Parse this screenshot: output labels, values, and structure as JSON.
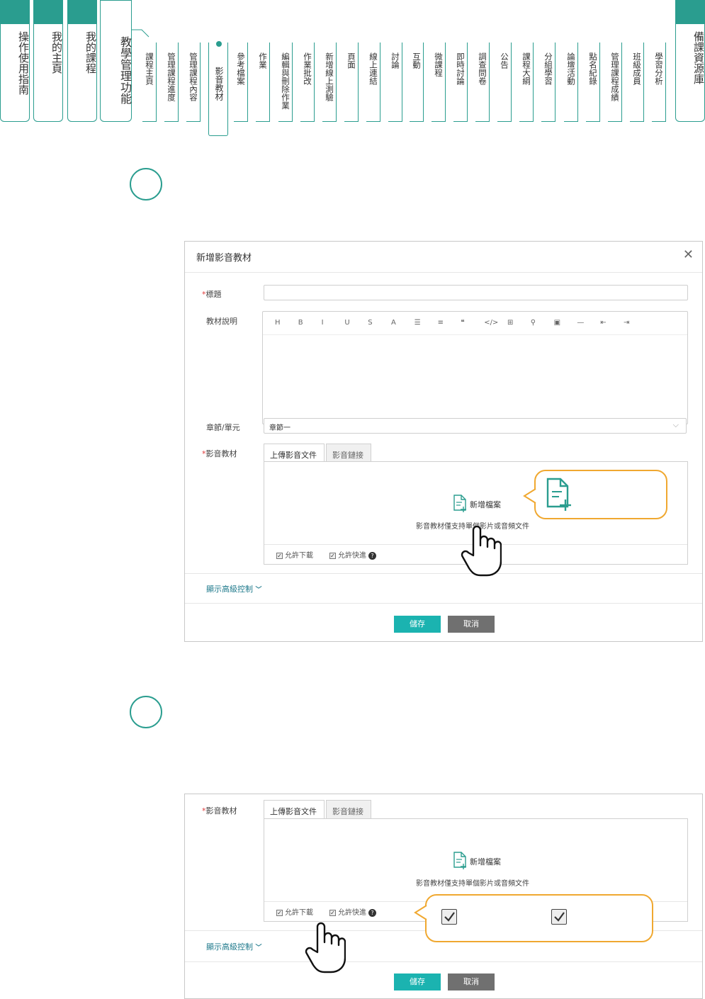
{
  "nav": {
    "main_tabs": [
      {
        "label": "操作使用指南"
      },
      {
        "label": "我的主頁"
      },
      {
        "label": "我的課程"
      },
      {
        "label": "教學管理功能"
      }
    ],
    "sub_tabs": [
      {
        "label": "課程主頁"
      },
      {
        "label": "管理課程進度"
      },
      {
        "label": "管理課程內容"
      },
      {
        "label": "影音教材"
      },
      {
        "label": "參考檔案"
      },
      {
        "label": "作業"
      },
      {
        "label": "編輯與刪除作業"
      },
      {
        "label": "作業批改"
      },
      {
        "label": "新增線上測驗"
      },
      {
        "label": "頁面"
      },
      {
        "label": "線上連結"
      },
      {
        "label": "討論"
      },
      {
        "label": "互動"
      },
      {
        "label": "微課程"
      },
      {
        "label": "即時討論"
      },
      {
        "label": "調查問卷"
      },
      {
        "label": "公告"
      },
      {
        "label": "課程大綱"
      },
      {
        "label": "分組學習"
      },
      {
        "label": "論壇活動"
      },
      {
        "label": "點名紀錄"
      },
      {
        "label": "管理課程成績"
      },
      {
        "label": "班級成員"
      },
      {
        "label": "學習分析"
      }
    ],
    "right_tab": "備課資源庫",
    "active_sub_tab": "影音教材"
  },
  "dialog1": {
    "title": "新增影音教材",
    "title_label": "標題",
    "desc_label": "教材說明",
    "toolbar": [
      "H",
      "B",
      "I",
      "U",
      "S",
      "A",
      "☰",
      "≡",
      "❝",
      "</>",
      "⊞",
      "⚲",
      "▣",
      "—",
      "⇤",
      "⇥"
    ],
    "chapter_label": "章節/單元",
    "chapter_value": "章節一",
    "media_label": "影音教材",
    "tab_upload": "上傳影音文件",
    "tab_link": "影音鏈接",
    "add_file": "新增檔案",
    "hint": "影音教材僅支持單個影片或音頻文件",
    "allow_download": "允許下載",
    "allow_fastforward": "允許快進",
    "advanced": "顯示高級控制",
    "save": "儲存",
    "cancel": "取消"
  },
  "dialog2": {
    "media_label": "影音教材",
    "tab_upload": "上傳影音文件",
    "tab_link": "影音鏈接",
    "add_file": "新增檔案",
    "hint": "影音教材僅支持單個影片或音頻文件",
    "allow_download": "允許下載",
    "allow_fastforward": "允許快進",
    "advanced": "顯示高級控制",
    "save": "儲存",
    "cancel": "取消"
  },
  "colors": {
    "accent": "#2a9d8f",
    "callout": "#f0a830",
    "save": "#1bb3b0",
    "cancel": "#707070"
  }
}
